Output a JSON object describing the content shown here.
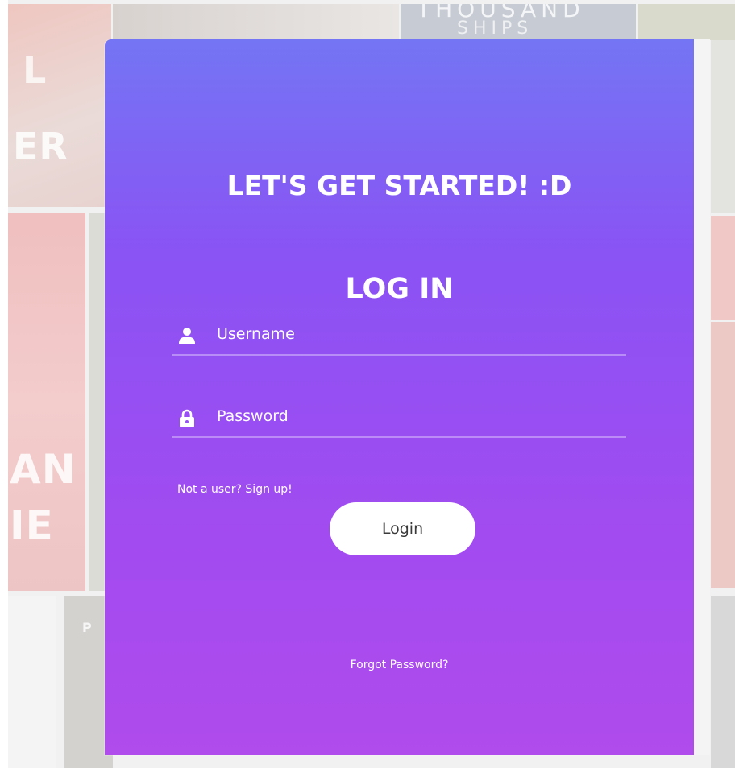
{
  "backdrop": {
    "cover_texts": [
      "L",
      "ER",
      "AN",
      "IE",
      "THOUSAND",
      "SHIPS",
      "P"
    ]
  },
  "login": {
    "title": "LET'S GET STARTED! :D",
    "subtitle": "LOG IN",
    "username_placeholder": "Username",
    "password_placeholder": "Password",
    "signup_link": "Not a user? Sign up!",
    "login_button": "Login",
    "forgot_link": "Forgot Password?"
  },
  "colors": {
    "card_gradient_top": "#7475f4",
    "card_gradient_bottom": "#b04bec",
    "button_bg": "#ffffff",
    "text": "#ffffff"
  },
  "icons": {
    "username": "user-icon",
    "password": "lock-icon"
  }
}
